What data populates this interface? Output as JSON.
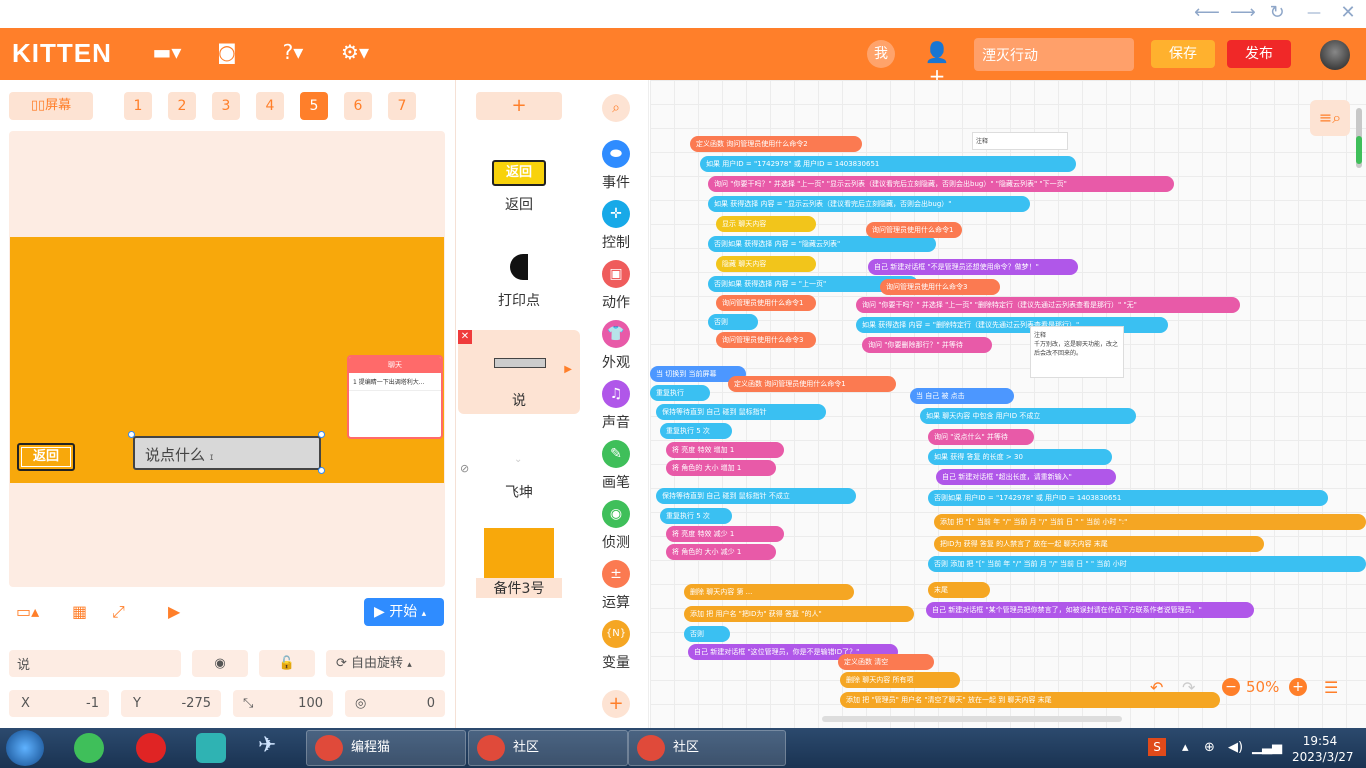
{
  "header": {
    "logo": "KITTEN",
    "me_label": "我",
    "search_placeholder": "湮灭行动",
    "save_label": "保存",
    "publish_label": "发布"
  },
  "screens": {
    "screen_label": "屏幕",
    "tabs": [
      "1",
      "2",
      "3",
      "4",
      "5",
      "6",
      "7"
    ],
    "active": "5"
  },
  "stage": {
    "back_button": "返回",
    "say_text": "说点什么",
    "chat_title": "聊天",
    "chat_line": "1 提编睛一下出调塔利大..."
  },
  "controls": {
    "start_label": "开始"
  },
  "props": {
    "name": "说",
    "rotation": "自由旋转",
    "x_label": "X",
    "x_value": "-1",
    "y_label": "Y",
    "y_value": "-275",
    "size_value": "100",
    "direction_value": "0"
  },
  "actors": [
    {
      "label": "返回",
      "icon_text": "返回"
    },
    {
      "label": "打印点"
    },
    {
      "label": "说"
    },
    {
      "label": "飞坤"
    },
    {
      "label": "备件3号"
    }
  ],
  "categories": [
    {
      "label": "事件",
      "color": "#2f8cff"
    },
    {
      "label": "控制",
      "color": "#17a9e8"
    },
    {
      "label": "动作",
      "color": "#ef5c5c"
    },
    {
      "label": "外观",
      "color": "#e85aa8"
    },
    {
      "label": "声音",
      "color": "#b057e9"
    },
    {
      "label": "画笔",
      "color": "#3fbf5a"
    },
    {
      "label": "侦测",
      "color": "#3fbf5a"
    },
    {
      "label": "运算",
      "color": "#fb7a51"
    },
    {
      "label": "变量",
      "color": "#f5a623"
    }
  ],
  "workspace": {
    "zoom": "50%"
  },
  "blocks": {
    "b1": "定义函数  询问管理员使用什么命令2",
    "b2": "如果    用户ID  =  \"1742978\"  或   用户ID  =  1403830651",
    "b3": "询问  \"你要干吗？\"  并选择  \"上一页\"  \"显示云列表（建议看完后立刻隐藏，否则会出bug）\"  \"隐藏云列表\"  \"下一页\"",
    "b4": "如果   获得选择  内容  =  \"显示云列表（建议看完后立刻隐藏，否则会出bug）\"",
    "b5": "显示  聊天内容",
    "b6": "否则如果   获得选择  内容  =  \"隐藏云列表\"",
    "b7": "隐藏  聊天内容",
    "b8": "否则如果   获得选择  内容  =  \"上一页\"",
    "b9": "询问管理员使用什么命令1",
    "b10": "否则",
    "b11": "询问管理员使用什么命令3",
    "b12": "自己  新建对话框  \"不是管理员还想使用命令？做梦！\"",
    "b13": "询问  \"你要干吗？\"  并选择  \"上一页\"  \"删除特定行（建议先通过云列表查看是那行）\"  \"无\"",
    "b14": "如果   获得选择  内容  =  \"删除特定行（建议先通过云列表查看是那行）\"",
    "b15": "询问  \"你要删除那行？\"  并等待",
    "b16": "当 切换到 当前屏幕",
    "b17": "重复执行",
    "b18": "保持等待直到   自己  碰到  鼠标指针",
    "b19": "重复执行  5  次",
    "b20": "将  亮度  特效  增加  1",
    "b21": "将 角色的 大小  增加  1",
    "b22": "保持等待直到   自己  碰到  鼠标指针  不成立",
    "b23": "将  亮度  特效  减少  1",
    "b24": "将 角色的 大小  减少  1",
    "b25": "定义函数  询问管理员使用什么命令1",
    "b26": "当  自己  被 点击",
    "b27": "如果   聊天内容  中包含   用户ID  不成立",
    "b28": "询问  \"说点什么\"  并等待",
    "b29": "如果   获得 答复  的长度  >  30",
    "b30": "自己  新建对话框  \"超出长度，请重新输入\"",
    "b31": "否则如果   用户ID  =  \"1742978\"  或   用户ID  =  1403830651",
    "b32": "添加  把 \"[\"  当前 年  \"/\"  当前 月  \"/\"  当前 日  \" \"  当前 小时  \":\"",
    "b33": "否则   添加  把 \"[\"  当前 年  \"/\"  当前 月  \"/\"  当前 日  \" \"  当前 小时",
    "b34": "自己  新建对话框  \"某个管理员把你禁言了，如被误封请在作品下方联系作者说管理员。\"",
    "b35": "自己  新建对话框  \"这位管理员，你是不是输错ID了？\"",
    "b36": "添加  把  \"管理员\"   用户名  \"清空了聊天\"  放在一起  到  聊天内容  末尾",
    "b37": "删除  聊天内容  第  ...",
    "b38": "添加  把  用户名  \"把ID为\"  获得 答复  \"的人\"",
    "b39": "否则",
    "b40": "删除  聊天内容  所有项",
    "note1": "注释",
    "note2": "千万别改，这是聊天功能，改之后会改不回来的。"
  },
  "taskbar": {
    "apps": [
      "编程猫",
      "社区",
      "社区"
    ],
    "time": "19:54",
    "date": "2023/3/27"
  }
}
